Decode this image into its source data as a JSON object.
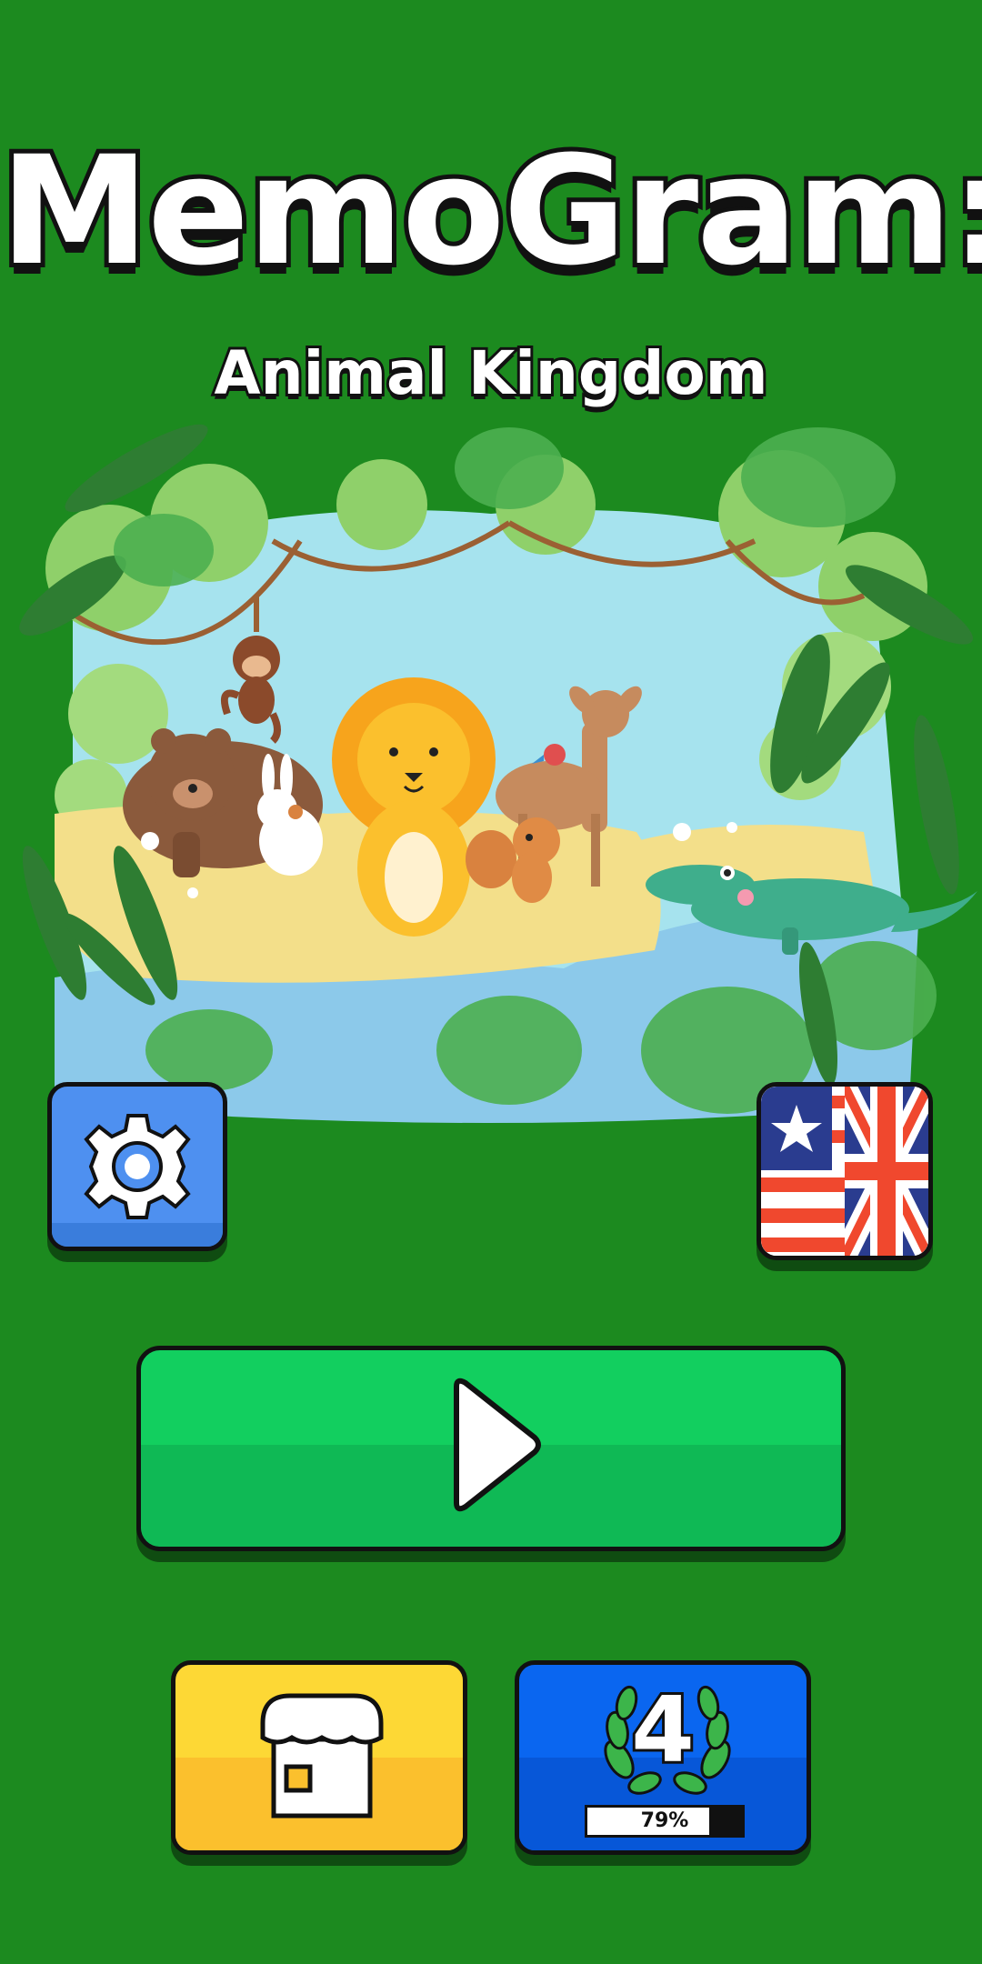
{
  "app": {
    "title": "MemoGram:",
    "subtitle": "Animal Kingdom"
  },
  "buttons": {
    "settings_icon": "gear-icon",
    "language_icon": "us-uk-flag-icon",
    "play_icon": "play-icon",
    "shop_icon": "shop-icon",
    "level_icon": "laurel-wreath-icon"
  },
  "level": {
    "number": "4",
    "progress_label": "79%",
    "progress": 0.79
  },
  "colors": {
    "background": "#1c8a1f",
    "play": "#12cf5f",
    "shop": "#fdd835",
    "level": "#0a66f0",
    "settings": "#4e90f0"
  }
}
